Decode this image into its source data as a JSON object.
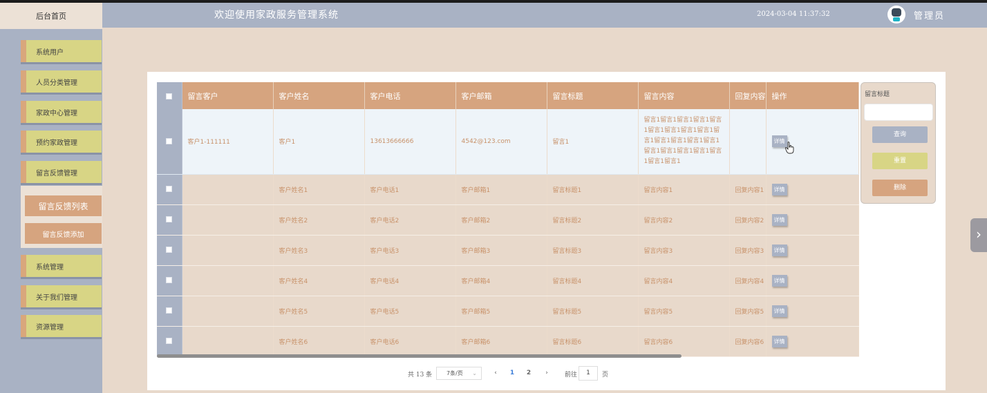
{
  "brand": "后台首页",
  "header": {
    "title": "欢迎使用家政服务管理系统",
    "time": "2024-03-04 11:37:32",
    "user": "管理员"
  },
  "sidebar": {
    "items": [
      "系统用户",
      "人员分类管理",
      "家政中心管理",
      "预约家政管理",
      "留言反馈管理"
    ],
    "submenu": [
      "留言反馈列表",
      "留言反馈添加"
    ],
    "items_after": [
      "系统管理",
      "关于我们管理",
      "资源管理"
    ]
  },
  "table": {
    "headers": [
      "留言客户",
      "客户姓名",
      "客户电话",
      "客户邮箱",
      "留言标题",
      "留言内容",
      "回复内容",
      "操作"
    ],
    "detail_label": "详情",
    "rows": [
      {
        "customer": "客户1-111111",
        "name": "客户1",
        "phone": "13613666666",
        "email": "4542@123.com",
        "title": "留言1",
        "content": "留言1留言1留言1留言1留言1留言1留言1留言1留言1留言1留言1留言1留言1留言1留言1留言1留言1留言1留言1留言1留言1",
        "reply": ""
      },
      {
        "customer": "",
        "name": "客户姓名1",
        "phone": "客户电话1",
        "email": "客户邮箱1",
        "title": "留言标题1",
        "content": "留言内容1",
        "reply": "回复内容1"
      },
      {
        "customer": "",
        "name": "客户姓名2",
        "phone": "客户电话2",
        "email": "客户邮箱2",
        "title": "留言标题2",
        "content": "留言内容2",
        "reply": "回复内容2"
      },
      {
        "customer": "",
        "name": "客户姓名3",
        "phone": "客户电话3",
        "email": "客户邮箱3",
        "title": "留言标题3",
        "content": "留言内容3",
        "reply": "回复内容3"
      },
      {
        "customer": "",
        "name": "客户姓名4",
        "phone": "客户电话4",
        "email": "客户邮箱4",
        "title": "留言标题4",
        "content": "留言内容4",
        "reply": "回复内容4"
      },
      {
        "customer": "",
        "name": "客户姓名5",
        "phone": "客户电话5",
        "email": "客户邮箱5",
        "title": "留言标题5",
        "content": "留言内容5",
        "reply": "回复内容5"
      },
      {
        "customer": "",
        "name": "客户姓名6",
        "phone": "客户电话6",
        "email": "客户邮箱6",
        "title": "留言标题6",
        "content": "留言内容6",
        "reply": "回复内容6"
      }
    ]
  },
  "search": {
    "label": "留言标题",
    "query": "查询",
    "reset": "重置",
    "delete": "删除"
  },
  "pagination": {
    "total": "共 13 条",
    "page_size": "7条/页",
    "prev": "‹",
    "pages": [
      "1",
      "2"
    ],
    "next": "›",
    "goto_label": "前往",
    "goto_value": "1",
    "goto_suffix": "页"
  },
  "side_tab": "›",
  "colors": {
    "sidebar": "#a9b2c4",
    "menu_item": "#d8d585",
    "accent": "#d6a47f",
    "background": "#e8d9cb"
  }
}
